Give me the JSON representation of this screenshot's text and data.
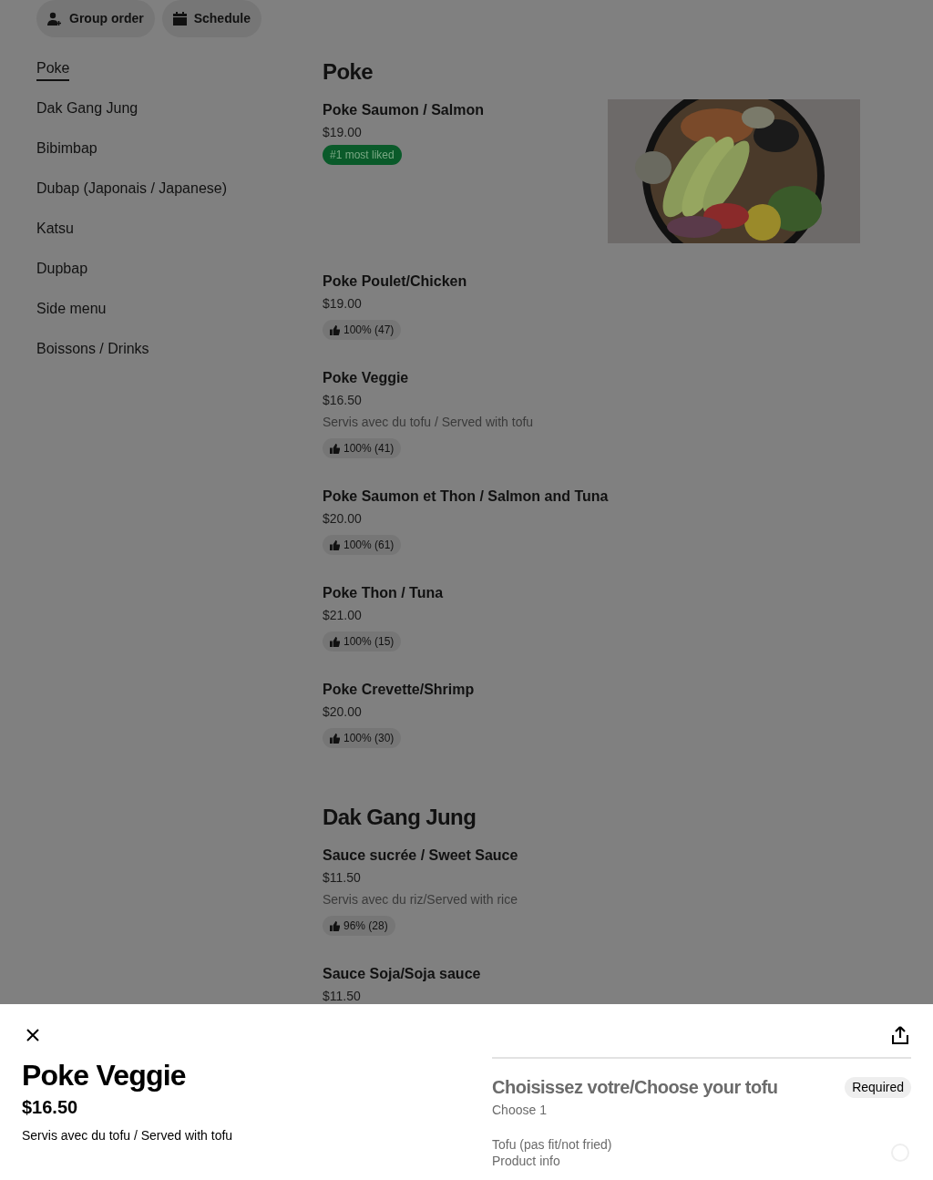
{
  "top_buttons": [
    {
      "kind": "group",
      "label": "Group order"
    },
    {
      "kind": "schedule",
      "label": "Schedule"
    }
  ],
  "categories": [
    {
      "label": "Poke",
      "selected": true
    },
    {
      "label": "Dak Gang Jung",
      "selected": false
    },
    {
      "label": "Bibimbap",
      "selected": false
    },
    {
      "label": "Dubap (Japonais / Japanese)",
      "selected": false
    },
    {
      "label": "Katsu",
      "selected": false
    },
    {
      "label": "Dupbap",
      "selected": false
    },
    {
      "label": "Side menu",
      "selected": false
    },
    {
      "label": "Boissons / Drinks",
      "selected": false
    }
  ],
  "sections": [
    {
      "title": "Poke",
      "items": [
        {
          "name": "Poke Saumon / Salmon",
          "price": "$19.00",
          "tag": {
            "kind": "badge",
            "text": "#1 most liked"
          }
        },
        {
          "name": "Poke Poulet/Chicken",
          "price": "$19.00",
          "tag": {
            "kind": "rating",
            "text": "100% (47)"
          }
        },
        {
          "name": "Poke Veggie",
          "price": "$16.50",
          "description": "Servis avec du tofu / Served with tofu",
          "tag": {
            "kind": "rating",
            "text": "100% (41)"
          }
        },
        {
          "name": "Poke Saumon et Thon / Salmon and Tuna",
          "price": "$20.00",
          "tag": {
            "kind": "rating",
            "text": "100% (61)"
          }
        },
        {
          "name": "Poke Thon / Tuna",
          "price": "$21.00",
          "tag": {
            "kind": "rating",
            "text": "100% (15)"
          }
        },
        {
          "name": "Poke Crevette/Shrimp",
          "price": "$20.00",
          "tag": {
            "kind": "rating",
            "text": "100% (30)"
          }
        }
      ]
    },
    {
      "title": "Dak Gang Jung",
      "items": [
        {
          "name": "Sauce sucrée / Sweet Sauce",
          "price": "$11.50",
          "description": "Servis avec du riz/Served with rice",
          "tag": {
            "kind": "rating",
            "text": "96% (28)"
          }
        },
        {
          "name": "Sauce Soja/Soja sauce",
          "price": "$11.50"
        }
      ]
    }
  ],
  "sheet": {
    "title": "Poke Veggie",
    "price": "$16.50",
    "description": "Servis avec du tofu / Served with tofu",
    "option_group": {
      "title": "Choisissez votre/Choose your tofu",
      "badge": "Required",
      "subtitle": "Choose 1",
      "options": [
        {
          "label": "Tofu (pas fit/not fried)",
          "info": "Product info",
          "selected": false
        }
      ]
    }
  }
}
